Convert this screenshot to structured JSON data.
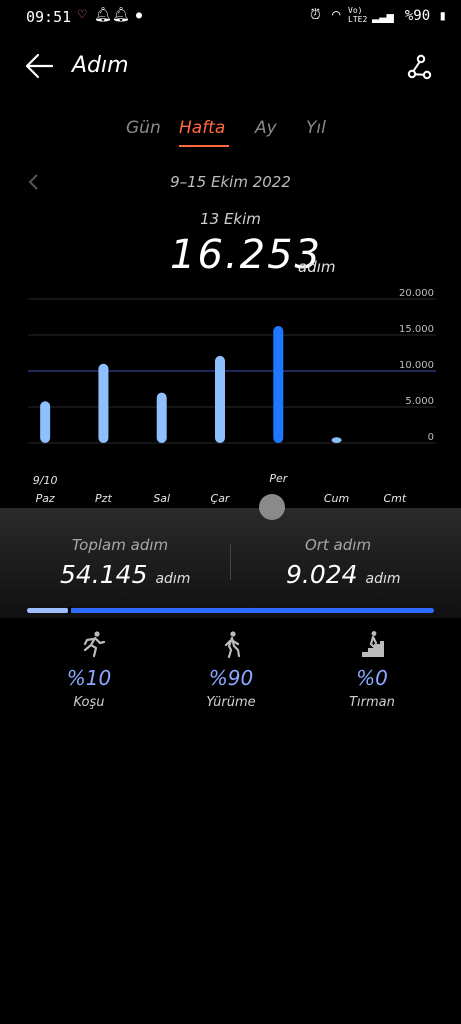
{
  "status_bar": {
    "time": "09:51",
    "network": "LTE2",
    "battery": "%90",
    "icons": [
      "heart-icon",
      "bell-icon",
      "bell-icon",
      "dot-icon",
      "alarm-icon",
      "wifi-icon",
      "signal-icon",
      "battery-icon"
    ]
  },
  "header": {
    "title": "Adım",
    "back_icon": "arrow-left-icon",
    "share_icon": "share-icon"
  },
  "tabs": [
    {
      "label": "Gün",
      "active": false
    },
    {
      "label": "Hafta",
      "active": true
    },
    {
      "label": "Ay",
      "active": false
    },
    {
      "label": "Yıl",
      "active": false
    }
  ],
  "date_range": "9–15 Ekim 2022",
  "selected": {
    "date": "13 Ekim",
    "steps": "16.253",
    "unit": "adım"
  },
  "chart_data": {
    "type": "bar",
    "categories": [
      "Paz",
      "Pzt",
      "Sal",
      "Çar",
      "Per",
      "Cum",
      "Cmt"
    ],
    "first_date_label": "9/10",
    "values": [
      5800,
      11000,
      7000,
      12100,
      16253,
      800,
      0
    ],
    "selected_index": 4,
    "y_ticks": [
      "20.000",
      "15.000",
      "10.000",
      "5.000",
      "0"
    ],
    "ylim": [
      0,
      20000
    ],
    "goal_line": 10000,
    "colors": {
      "bar": "#8ec0ff",
      "selected_bar": "#1e78ff",
      "goal": "#3b4fb0"
    }
  },
  "summary": {
    "total_label": "Toplam adım",
    "total_value": "54.145",
    "avg_label": "Ort adım",
    "avg_value": "9.024",
    "unit": "adım"
  },
  "activity_split": {
    "run_fraction": 0.1
  },
  "activities": [
    {
      "icon": "running-icon",
      "pct": "%10",
      "label": "Koşu"
    },
    {
      "icon": "walking-icon",
      "pct": "%90",
      "label": "Yürüme"
    },
    {
      "icon": "stairs-icon",
      "pct": "%0",
      "label": "Tırman"
    }
  ]
}
